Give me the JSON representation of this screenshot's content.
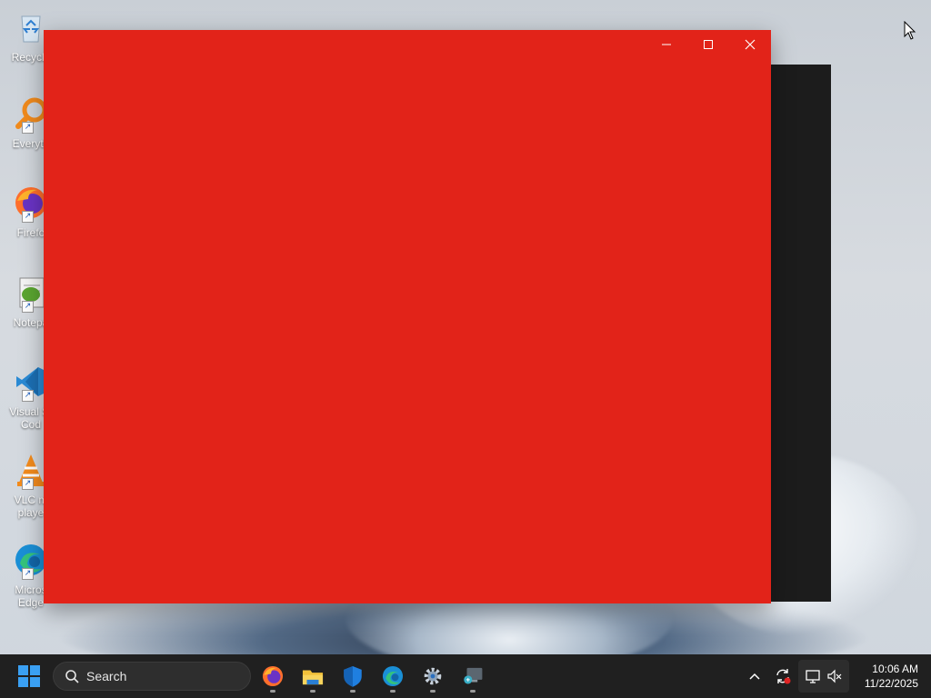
{
  "desktop": {
    "icons": [
      {
        "label": "Recycle",
        "icon": "recycle-bin-icon"
      },
      {
        "label": "Everyth",
        "icon": "everything-search-icon"
      },
      {
        "label": "Firefo",
        "icon": "firefox-icon"
      },
      {
        "label": "Notepa",
        "icon": "notepad-plus-plus-icon"
      },
      {
        "label": "Visual St",
        "label2": "Cod",
        "icon": "vscode-icon"
      },
      {
        "label": "VLC m",
        "label2": "playe",
        "icon": "vlc-icon"
      },
      {
        "label": "Micros",
        "label2": "Edge",
        "icon": "edge-icon"
      }
    ]
  },
  "window": {
    "background": "#e22319",
    "controls": [
      "minimize-icon",
      "maximize-icon",
      "close-icon"
    ]
  },
  "taskbar": {
    "search_label": "Search",
    "apps": [
      "firefox-icon",
      "file-explorer-icon",
      "windows-security-icon",
      "edge-icon",
      "settings-gear-icon",
      "remote-desktop-icon"
    ],
    "tray_icons": [
      "chevron-up-icon",
      "sync-icon",
      "display-icon",
      "speaker-muted-icon"
    ],
    "time": "10:06 AM",
    "date": "11/22/2025"
  },
  "colors": {
    "accent": "#3aa0f3",
    "taskbar": "#202020",
    "window_red": "#e22319"
  }
}
